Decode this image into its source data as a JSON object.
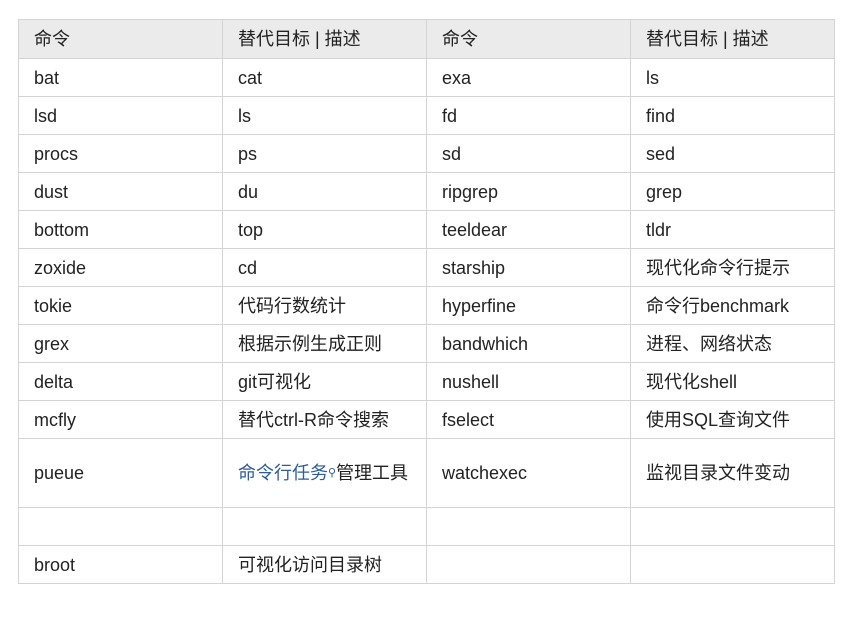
{
  "headers": [
    "命令",
    "替代目标 | 描述",
    "命令",
    "替代目标 | 描述"
  ],
  "rows": [
    [
      "bat",
      "cat",
      "exa",
      "ls"
    ],
    [
      "lsd",
      "ls",
      "fd",
      "find"
    ],
    [
      "procs",
      "ps",
      "sd",
      "sed"
    ],
    [
      "dust",
      "du",
      "ripgrep",
      "grep"
    ],
    [
      "bottom",
      "top",
      "teeldear",
      "tldr"
    ],
    [
      "zoxide",
      "cd",
      "starship",
      "现代化命令行提示"
    ],
    [
      "tokie",
      "代码行数统计",
      "hyperfine",
      "命令行benchmark"
    ],
    [
      "grex",
      "根据示例生成正则",
      "bandwhich",
      "进程、网络状态"
    ],
    [
      "delta",
      "git可视化",
      "nushell",
      "现代化shell"
    ],
    [
      "mcfly",
      "替代ctrl-R命令搜索",
      "fselect",
      "使用SQL查询文件"
    ],
    [
      "pueue",
      "",
      "watchexec",
      "监视目录文件变动"
    ],
    [
      "",
      "",
      "",
      ""
    ],
    [
      "broot",
      "可视化访问目录树",
      "",
      ""
    ]
  ],
  "pueue_desc": {
    "link": "命令行任务",
    "rest": "管理工具"
  }
}
